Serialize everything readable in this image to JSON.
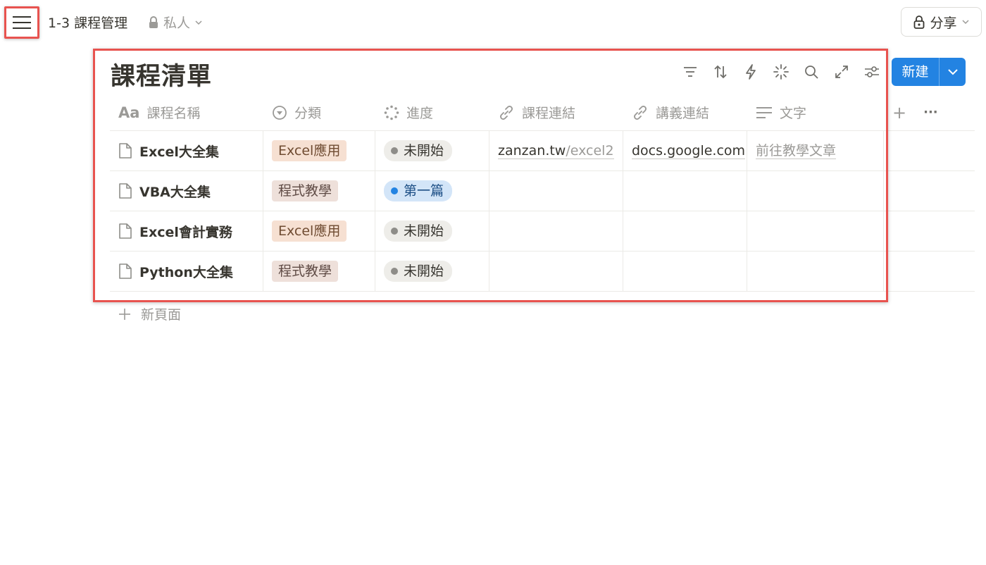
{
  "topbar": {
    "page_title": "1-3 課程管理",
    "privacy_label": "私人",
    "share_label": "分享"
  },
  "database": {
    "title": "課程清單",
    "new_button_label": "新建",
    "toolbar_icons": [
      "filter-icon",
      "sort-icon",
      "automation-icon",
      "ai-icon",
      "search-icon",
      "expand-icon",
      "settings-icon"
    ]
  },
  "table": {
    "columns": [
      {
        "label": "課程名稱",
        "icon": "text-type-icon"
      },
      {
        "label": "分類",
        "icon": "select-icon"
      },
      {
        "label": "進度",
        "icon": "status-icon"
      },
      {
        "label": "課程連結",
        "icon": "link-icon"
      },
      {
        "label": "講義連結",
        "icon": "link-icon"
      },
      {
        "label": "文字",
        "icon": "text-lines-icon"
      }
    ],
    "rows": [
      {
        "name": "Excel大全集",
        "category": "Excel應用",
        "category_style": "excel",
        "status": "未開始",
        "status_style": "gray",
        "course_link_main": "zanzan.tw",
        "course_link_rest": "/excel2",
        "handout_link": "docs.google.com",
        "text": "前往教學文章"
      },
      {
        "name": "VBA大全集",
        "category": "程式教學",
        "category_style": "prog",
        "status": "第一篇",
        "status_style": "blue",
        "course_link_main": "",
        "course_link_rest": "",
        "handout_link": "",
        "text": ""
      },
      {
        "name": "Excel會計實務",
        "category": "Excel應用",
        "category_style": "excel",
        "status": "未開始",
        "status_style": "gray",
        "course_link_main": "",
        "course_link_rest": "",
        "handout_link": "",
        "text": ""
      },
      {
        "name": "Python大全集",
        "category": "程式教學",
        "category_style": "prog",
        "status": "未開始",
        "status_style": "gray",
        "course_link_main": "",
        "course_link_rest": "",
        "handout_link": "",
        "text": ""
      }
    ],
    "add_column_symbol": "+",
    "more_symbol": "···"
  },
  "add_page_label": "新頁面",
  "colors": {
    "accent_blue": "#2383e2",
    "highlight_red": "#e8534f",
    "muted_text": "#9b9a97"
  }
}
